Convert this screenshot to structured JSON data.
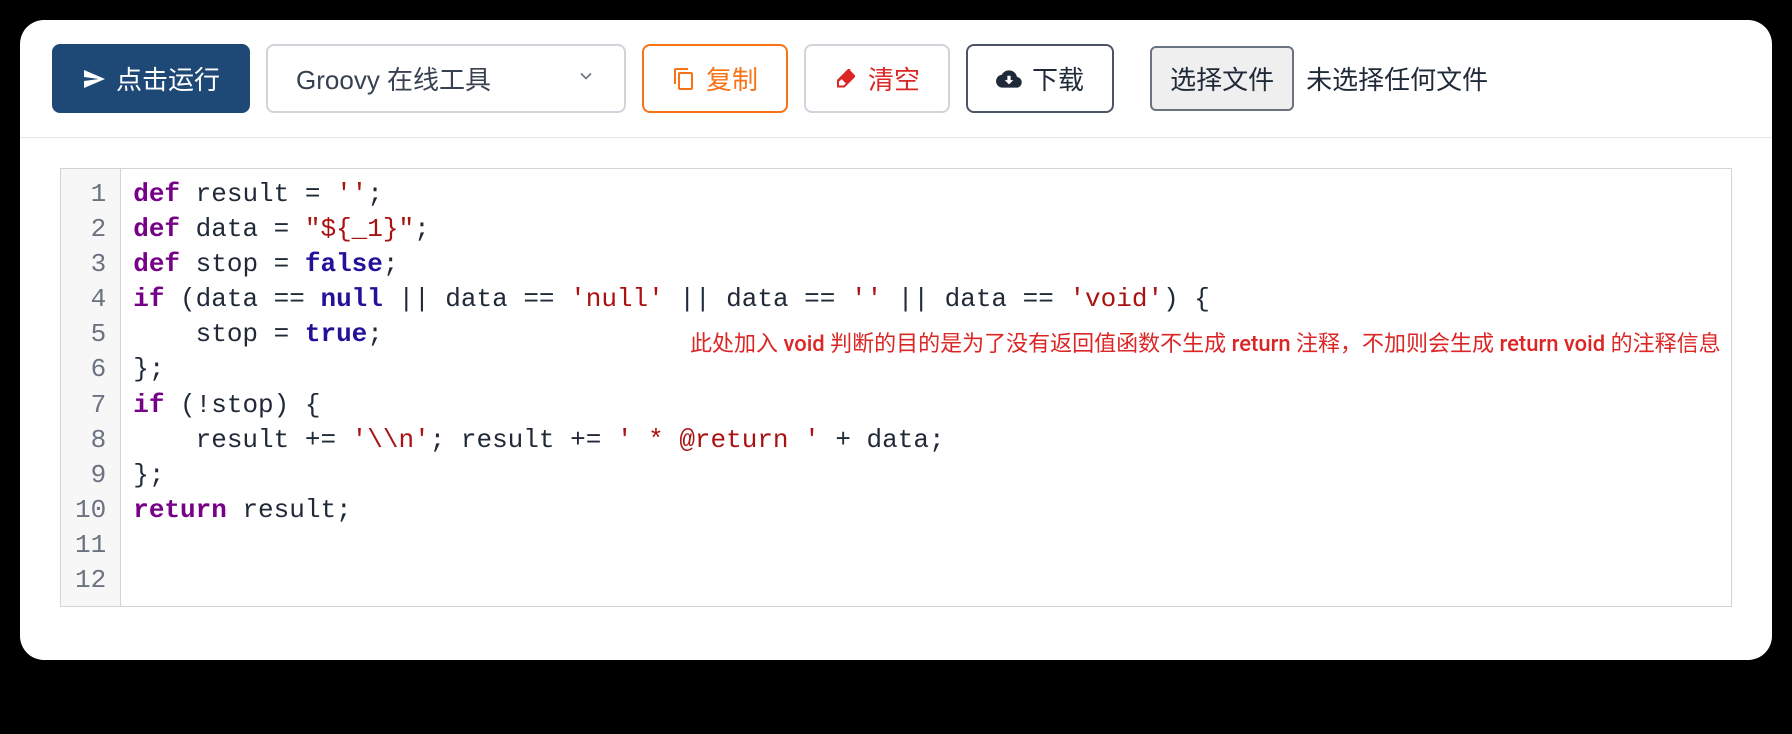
{
  "toolbar": {
    "run_label": "点击运行",
    "language_selected": "Groovy 在线工具",
    "copy_label": "复制",
    "clear_label": "清空",
    "download_label": "下载",
    "choose_file_label": "选择文件",
    "no_file_label": "未选择任何文件"
  },
  "code": {
    "lines": [
      {
        "n": "1",
        "tokens": [
          {
            "t": "def ",
            "c": "kw"
          },
          {
            "t": "result = ",
            "c": "var"
          },
          {
            "t": "''",
            "c": "str"
          },
          {
            "t": ";",
            "c": "op"
          }
        ]
      },
      {
        "n": "2",
        "tokens": [
          {
            "t": "def ",
            "c": "kw"
          },
          {
            "t": "data = ",
            "c": "var"
          },
          {
            "t": "\"${_1}\"",
            "c": "str"
          },
          {
            "t": ";",
            "c": "op"
          }
        ]
      },
      {
        "n": "3",
        "tokens": [
          {
            "t": "def ",
            "c": "kw"
          },
          {
            "t": "stop = ",
            "c": "var"
          },
          {
            "t": "false",
            "c": "bool"
          },
          {
            "t": ";",
            "c": "op"
          }
        ]
      },
      {
        "n": "4",
        "tokens": [
          {
            "t": "if ",
            "c": "kw"
          },
          {
            "t": "(data == ",
            "c": "var"
          },
          {
            "t": "null",
            "c": "null"
          },
          {
            "t": " || data == ",
            "c": "var"
          },
          {
            "t": "'null'",
            "c": "str"
          },
          {
            "t": " || data == ",
            "c": "var"
          },
          {
            "t": "''",
            "c": "str"
          },
          {
            "t": " || data == ",
            "c": "var"
          },
          {
            "t": "'void'",
            "c": "str"
          },
          {
            "t": ") {",
            "c": "op"
          }
        ]
      },
      {
        "n": "5",
        "tokens": [
          {
            "t": "    stop = ",
            "c": "var"
          },
          {
            "t": "true",
            "c": "bool"
          },
          {
            "t": ";",
            "c": "op"
          }
        ]
      },
      {
        "n": "6",
        "tokens": [
          {
            "t": "};",
            "c": "op"
          }
        ]
      },
      {
        "n": "7",
        "tokens": [
          {
            "t": "if ",
            "c": "kw"
          },
          {
            "t": "(!stop) {",
            "c": "op"
          }
        ]
      },
      {
        "n": "8",
        "tokens": [
          {
            "t": "    result += ",
            "c": "var"
          },
          {
            "t": "'\\\\n'",
            "c": "str"
          },
          {
            "t": "; result += ",
            "c": "var"
          },
          {
            "t": "' * @return '",
            "c": "str"
          },
          {
            "t": " + data;",
            "c": "op"
          }
        ]
      },
      {
        "n": "9",
        "tokens": [
          {
            "t": "};",
            "c": "op"
          }
        ]
      },
      {
        "n": "10",
        "tokens": [
          {
            "t": "return ",
            "c": "kw"
          },
          {
            "t": "result;",
            "c": "var"
          }
        ]
      },
      {
        "n": "11",
        "tokens": []
      },
      {
        "n": "12",
        "tokens": []
      }
    ]
  },
  "annotation": "此处加入 void 判断的目的是为了没有返回值函数不生成 return 注释，不加则会生成 return void 的注释信息"
}
